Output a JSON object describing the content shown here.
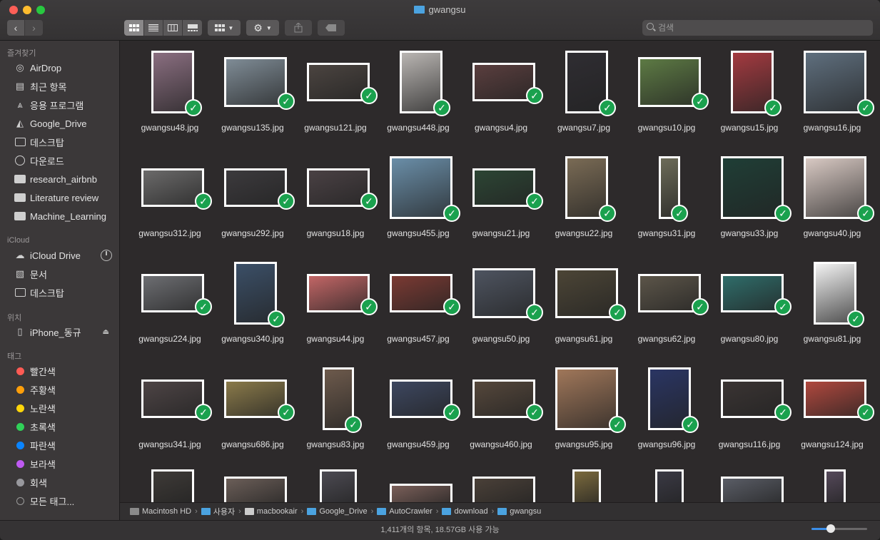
{
  "window": {
    "title": "gwangsu"
  },
  "toolbar": {
    "search_placeholder": "검색"
  },
  "sidebar": {
    "sections": [
      {
        "heading": "즐겨찾기",
        "items": [
          {
            "label": "AirDrop",
            "icon": "airdrop-icon"
          },
          {
            "label": "최근 항목",
            "icon": "recents-icon"
          },
          {
            "label": "응용 프로그램",
            "icon": "applications-icon"
          },
          {
            "label": "Google_Drive",
            "icon": "google-drive-icon"
          },
          {
            "label": "데스크탑",
            "icon": "desktop-icon"
          },
          {
            "label": "다운로드",
            "icon": "downloads-icon"
          },
          {
            "label": "research_airbnb",
            "icon": "folder-icon"
          },
          {
            "label": "Literature review",
            "icon": "folder-icon"
          },
          {
            "label": "Machine_Learning",
            "icon": "folder-icon"
          }
        ]
      },
      {
        "heading": "iCloud",
        "items": [
          {
            "label": "iCloud Drive",
            "icon": "cloud-icon"
          },
          {
            "label": "문서",
            "icon": "documents-icon"
          },
          {
            "label": "데스크탑",
            "icon": "desktop-icon"
          }
        ]
      },
      {
        "heading": "위치",
        "items": [
          {
            "label": "iPhone_동규",
            "icon": "iphone-icon"
          }
        ]
      },
      {
        "heading": "태그",
        "items": [
          {
            "label": "빨간색",
            "color": "#ff5b54"
          },
          {
            "label": "주황색",
            "color": "#ff9f0a"
          },
          {
            "label": "노란색",
            "color": "#ffd60a"
          },
          {
            "label": "초록색",
            "color": "#30d158"
          },
          {
            "label": "파란색",
            "color": "#0a84ff"
          },
          {
            "label": "보라색",
            "color": "#bf5af2"
          },
          {
            "label": "회색",
            "color": "#98989d"
          },
          {
            "label": "모든 태그...",
            "color": "#6b6b6b"
          }
        ]
      }
    ]
  },
  "files": [
    {
      "name": "gwangsu48.jpg",
      "orient": "p",
      "color": "#8a6e80"
    },
    {
      "name": "gwangsu135.jpg",
      "orient": "l",
      "color": "#7f8c96"
    },
    {
      "name": "gwangsu121.jpg",
      "orient": "w",
      "color": "#4b4440"
    },
    {
      "name": "gwangsu448.jpg",
      "orient": "p",
      "color": "#b9b5b2"
    },
    {
      "name": "gwangsu4.jpg",
      "orient": "w",
      "color": "#5a3e3e"
    },
    {
      "name": "gwangsu7.jpg",
      "orient": "p",
      "color": "#2f2d32"
    },
    {
      "name": "gwangsu10.jpg",
      "orient": "l",
      "color": "#5d7a44"
    },
    {
      "name": "gwangsu15.jpg",
      "orient": "p",
      "color": "#a33a40"
    },
    {
      "name": "gwangsu16.jpg",
      "orient": "s",
      "color": "#5f6f7e"
    },
    {
      "name": "gwangsu312.jpg",
      "orient": "w",
      "color": "#6b6a6a"
    },
    {
      "name": "gwangsu292.jpg",
      "orient": "w",
      "color": "#3c3a3d"
    },
    {
      "name": "gwangsu18.jpg",
      "orient": "w",
      "color": "#4a4144"
    },
    {
      "name": "gwangsu455.jpg",
      "orient": "s",
      "color": "#6a8ea8"
    },
    {
      "name": "gwangsu21.jpg",
      "orient": "w",
      "color": "#2c4534"
    },
    {
      "name": "gwangsu22.jpg",
      "orient": "p",
      "color": "#7a6b55"
    },
    {
      "name": "gwangsu31.jpg",
      "orient": "t",
      "color": "#6c6b58"
    },
    {
      "name": "gwangsu33.jpg",
      "orient": "s",
      "color": "#1f3e36"
    },
    {
      "name": "gwangsu40.jpg",
      "orient": "s",
      "color": "#d8c9c3"
    },
    {
      "name": "gwangsu224.jpg",
      "orient": "w",
      "color": "#6d6e72"
    },
    {
      "name": "gwangsu340.jpg",
      "orient": "p",
      "color": "#3b4f67"
    },
    {
      "name": "gwangsu44.jpg",
      "orient": "w",
      "color": "#c26666"
    },
    {
      "name": "gwangsu457.jpg",
      "orient": "w",
      "color": "#7b3a33"
    },
    {
      "name": "gwangsu50.jpg",
      "orient": "l",
      "color": "#4e5460"
    },
    {
      "name": "gwangsu61.jpg",
      "orient": "l",
      "color": "#4c4536"
    },
    {
      "name": "gwangsu62.jpg",
      "orient": "w",
      "color": "#5c5549"
    },
    {
      "name": "gwangsu80.jpg",
      "orient": "w",
      "color": "#2f6d6a"
    },
    {
      "name": "gwangsu81.jpg",
      "orient": "p",
      "color": "#f2f2f2"
    },
    {
      "name": "gwangsu341.jpg",
      "orient": "w",
      "color": "#4d4445"
    },
    {
      "name": "gwangsu686.jpg",
      "orient": "w",
      "color": "#8a7a4a"
    },
    {
      "name": "gwangsu83.jpg",
      "orient": "t2",
      "color": "#6d5a4c"
    },
    {
      "name": "gwangsu459.jpg",
      "orient": "w",
      "color": "#3d4760"
    },
    {
      "name": "gwangsu460.jpg",
      "orient": "w",
      "color": "#55473b"
    },
    {
      "name": "gwangsu95.jpg",
      "orient": "s",
      "color": "#a0775a"
    },
    {
      "name": "gwangsu96.jpg",
      "orient": "p",
      "color": "#2a3563"
    },
    {
      "name": "gwangsu116.jpg",
      "orient": "w",
      "color": "#3a3433"
    },
    {
      "name": "gwangsu124.jpg",
      "orient": "w",
      "color": "#b0483e"
    }
  ],
  "partial_row_colors": [
    "#3e3a37",
    "#6b5e58",
    "#4c4a52",
    "#7a5f59",
    "#4a4038",
    "#7b6a3d",
    "#3a3944",
    "#5a5d66",
    "#55495a"
  ],
  "pathbar": [
    {
      "label": "Macintosh HD",
      "color": "#8a8a8a"
    },
    {
      "label": "사용자",
      "color": "#4ba3e0"
    },
    {
      "label": "macbookair",
      "color": "#cccccc"
    },
    {
      "label": "Google_Drive",
      "color": "#4ba3e0"
    },
    {
      "label": "AutoCrawler",
      "color": "#4ba3e0"
    },
    {
      "label": "download",
      "color": "#4ba3e0"
    },
    {
      "label": "gwangsu",
      "color": "#4ba3e0"
    }
  ],
  "status": {
    "text": "1,411개의 항목, 18.57GB 사용 가능",
    "icon_size_level": 0.35
  }
}
